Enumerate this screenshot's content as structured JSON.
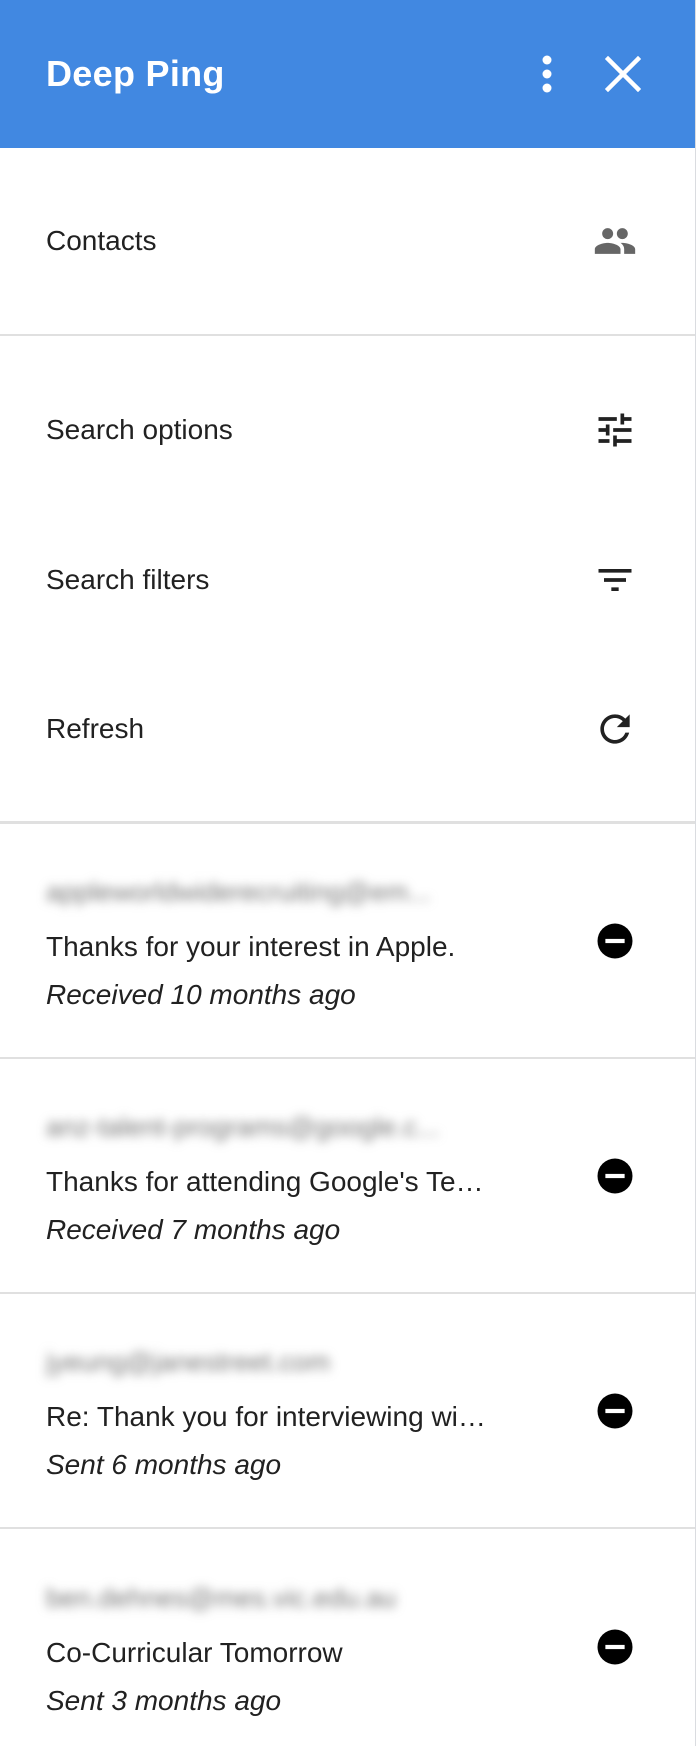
{
  "header": {
    "title": "Deep Ping",
    "more_icon": "more-vert-icon",
    "close_icon": "close-icon",
    "color": "#4188e1"
  },
  "contacts": {
    "label": "Contacts",
    "icon": "people-icon"
  },
  "actions": [
    {
      "label": "Search options",
      "icon": "tune-icon"
    },
    {
      "label": "Search filters",
      "icon": "filter-list-icon"
    },
    {
      "label": "Refresh",
      "icon": "refresh-icon"
    }
  ],
  "emails": [
    {
      "sender": "appleworldwiderecruiting@em...",
      "subject": "Thanks for your interest in Apple.",
      "time": "Received 10 months ago",
      "action_icon": "remove-circle-icon"
    },
    {
      "sender": "anz-talent-programs@google.c...",
      "subject": "Thanks for attending Google's Te…",
      "time": "Received 7 months ago",
      "action_icon": "remove-circle-icon"
    },
    {
      "sender": "jyeung@janestreet.com",
      "subject": "Re: Thank you for interviewing wi…",
      "time": "Sent 6 months ago",
      "action_icon": "remove-circle-icon"
    },
    {
      "sender": "ben.dehnes@mes.vic.edu.au",
      "subject": "Co-Curricular Tomorrow",
      "time": "Sent 3 months ago",
      "action_icon": "remove-circle-icon"
    }
  ]
}
